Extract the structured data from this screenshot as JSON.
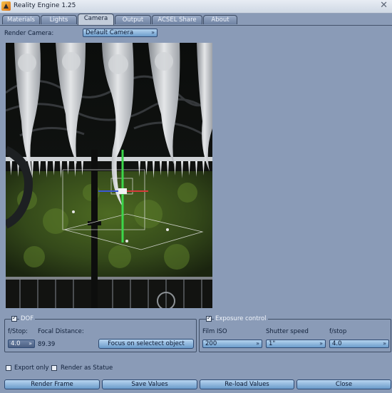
{
  "window": {
    "title": "Reality Engine 1.25",
    "close_glyph": "✕"
  },
  "tabs": [
    {
      "label": "Materials"
    },
    {
      "label": "Lights"
    },
    {
      "label": "Camera"
    },
    {
      "label": "Output"
    },
    {
      "label": "ACSEL Share"
    },
    {
      "label": "About"
    }
  ],
  "camera": {
    "render_camera_label": "Render Camera:",
    "render_camera_value": "Default Camera"
  },
  "dof": {
    "title": "DOF",
    "enabled": true,
    "fstop_label": "f/Stop:",
    "fstop_value": "4.0",
    "focal_distance_label": "Focal Distance:",
    "focal_distance_value": "89.39",
    "focus_button": "Focus on selectect object"
  },
  "exposure": {
    "title": "Exposure control",
    "enabled": true,
    "film_iso_label": "Film ISO",
    "film_iso_value": "200",
    "shutter_label": "Shutter speed",
    "shutter_value": "1\"",
    "fstop_label": "f/stop",
    "fstop_value": "4.0"
  },
  "options": {
    "export_only": "Export only",
    "render_as_statue": "Render as Statue"
  },
  "buttons": {
    "render_frame": "Render Frame",
    "save_values": "Save Values",
    "reload_values": "Re-load Values",
    "close": "Close"
  },
  "icons": {
    "dropdown": "chevron-down-icon",
    "checkbox": "check-icon"
  },
  "colors": {
    "panel_bg": "#8a9bb7",
    "button_top": "#b8d5f0",
    "button_bottom": "#6a9bca",
    "tab_active": "#c2ccda"
  }
}
